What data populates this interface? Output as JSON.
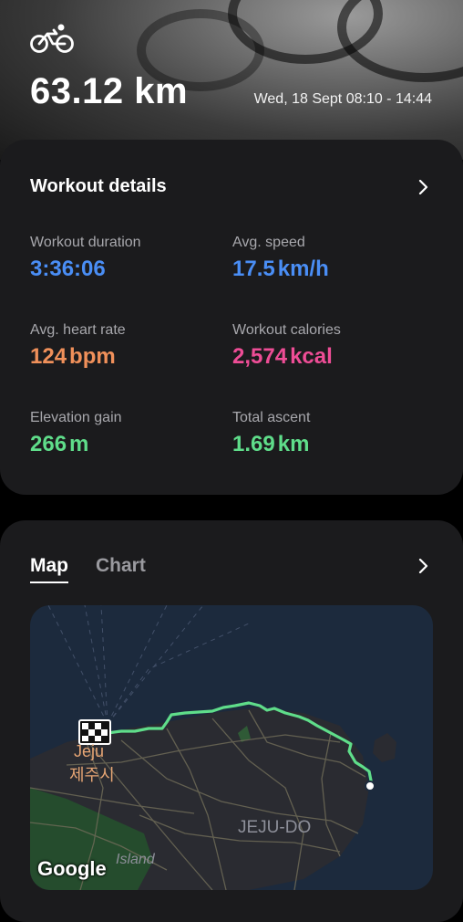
{
  "header": {
    "activity_icon": "bicycle-icon",
    "distance": "63.12 km",
    "datetime": "Wed, 18 Sept 08:10 - 14:44"
  },
  "workout_details": {
    "title": "Workout details",
    "stats": [
      {
        "label": "Workout duration",
        "value": "3:36:06",
        "unit": "",
        "color": "#4a8ef5"
      },
      {
        "label": "Avg. speed",
        "value": "17.5",
        "unit": "km/h",
        "color": "#4a8ef5"
      },
      {
        "label": "Avg. heart rate",
        "value": "124",
        "unit": "bpm",
        "color": "#f0905a"
      },
      {
        "label": "Workout calories",
        "value": "2,574",
        "unit": "kcal",
        "color": "#ee4d96"
      },
      {
        "label": "Elevation gain",
        "value": "266",
        "unit": "m",
        "color": "#5fdd8a"
      },
      {
        "label": "Total ascent",
        "value": "1.69",
        "unit": "km",
        "color": "#5fdd8a"
      }
    ]
  },
  "map_card": {
    "tabs": [
      {
        "label": "Map",
        "active": true
      },
      {
        "label": "Chart",
        "active": false
      }
    ],
    "map": {
      "city_label_en": "Jeju",
      "city_label_ko": "제주시",
      "region_label": "JEJU-DO",
      "island_label": "Island",
      "attribution": "Google",
      "route_color": "#5fdd8a",
      "start_marker": "checkered-flag-icon",
      "end_marker": "white-dot"
    }
  }
}
